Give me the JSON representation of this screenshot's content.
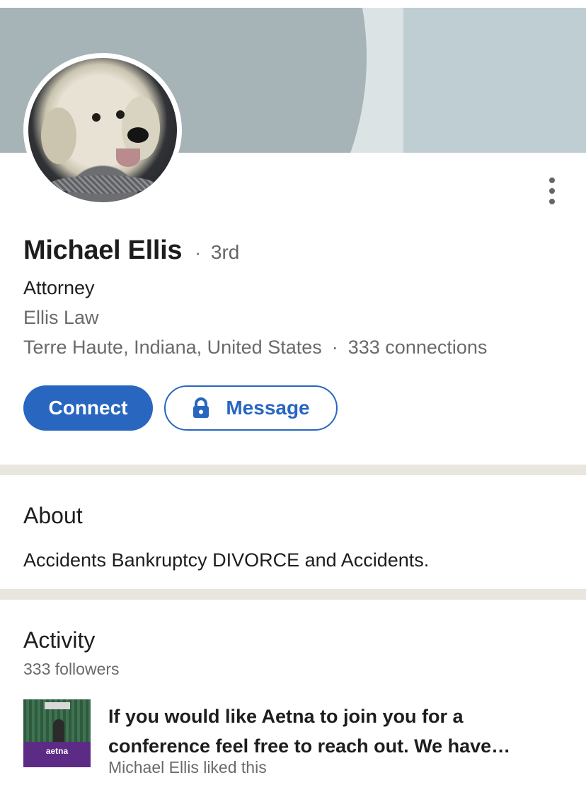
{
  "profile": {
    "name": "Michael Ellis",
    "degree_separator": "·",
    "degree": "3rd",
    "headline": "Attorney",
    "company": "Ellis Law",
    "location": "Terre Haute, Indiana, United States",
    "location_separator": "·",
    "connections": "333 connections"
  },
  "actions": {
    "connect_label": "Connect",
    "message_label": "Message"
  },
  "about": {
    "title": "About",
    "text": "Accidents Bankruptcy DIVORCE and Accidents."
  },
  "activity": {
    "title": "Activity",
    "followers": "333 followers",
    "post": {
      "text": "If you would like Aetna to join you for a conference feel free to reach out. We have…",
      "subtext": "Michael Ellis liked this",
      "thumb_logo": "aetna"
    }
  },
  "colors": {
    "accent": "#2866c0",
    "divider": "#e9e5df",
    "secondary_text": "#6a6a6a"
  },
  "icons": {
    "more": "more-vertical-icon",
    "lock": "lock-icon"
  }
}
